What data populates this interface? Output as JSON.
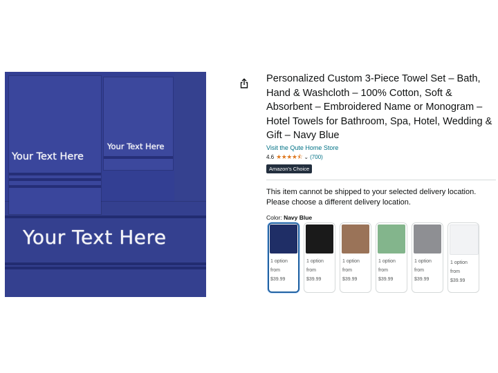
{
  "image": {
    "bath_text": "Your Text Here",
    "hand_text": "Your Text Here",
    "wash_text": "Your Text Here"
  },
  "product": {
    "title": "Personalized Custom 3-Piece Towel Set – Bath, Hand & Washcloth – 100% Cotton, Soft & Absorbent – Embroidered Name or Monogram – Hotel Towels for Bathroom, Spa, Hotel, Wedding & Gift – Navy Blue",
    "store_link": "Visit the Qute Home Store",
    "rating": "4.6",
    "stars": "★★★★⯪",
    "rating_count": "(700)",
    "badge": "Amazon's Choice"
  },
  "shipping_message": "This item cannot be shipped to your selected delivery location. Please choose a different delivery location.",
  "color": {
    "label": "Color:",
    "selected": "Navy Blue"
  },
  "swatches": [
    {
      "color": "#1f2e66",
      "line1": "1 option",
      "line2": "from",
      "price": "$39.99"
    },
    {
      "color": "#1a1a1a",
      "line1": "1 option",
      "line2": "from",
      "price": "$39.99"
    },
    {
      "color": "#9a7358",
      "line1": "1 option",
      "line2": "from",
      "price": "$39.99"
    },
    {
      "color": "#83b58c",
      "line1": "1 option",
      "line2": "from",
      "price": "$39.99"
    },
    {
      "color": "#8e8f93",
      "line1": "1 option",
      "line2": "from",
      "price": "$39.99"
    },
    {
      "color": "#f2f3f5",
      "line1": "1 option",
      "line2": "from",
      "price": "$39.99"
    }
  ],
  "icons": {
    "share": "share-icon"
  }
}
